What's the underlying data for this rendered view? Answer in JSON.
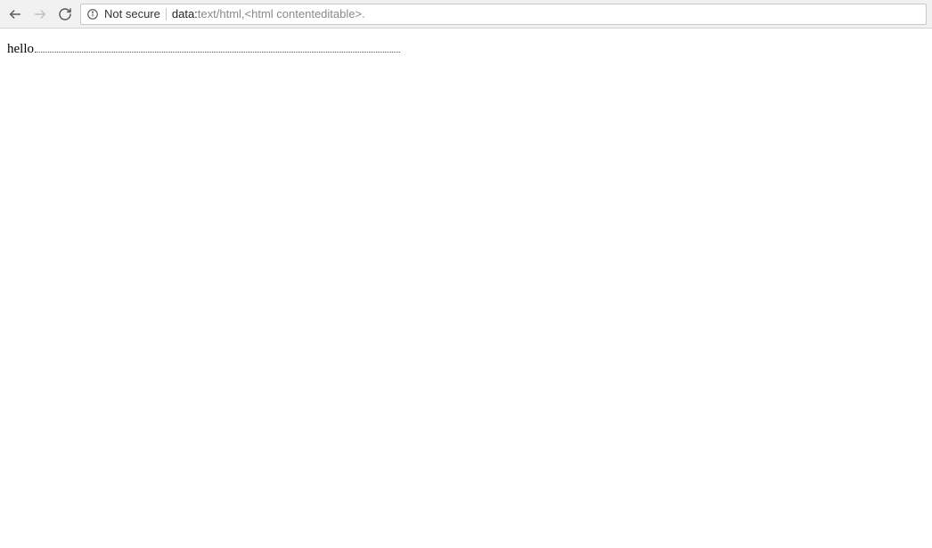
{
  "toolbar": {
    "security_label": "Not secure",
    "url_scheme": "data:",
    "url_rest": "text/html,<html contenteditable>."
  },
  "content": {
    "text": "hello"
  }
}
